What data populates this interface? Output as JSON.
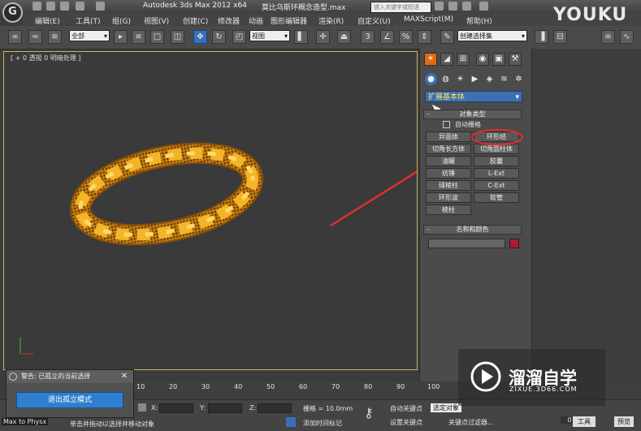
{
  "titlebar": {
    "app_title": "Autodesk 3ds Max  2012 x64",
    "file_title": "莫比乌斯环概念造型.max",
    "search_placeholder": "键入关键字或短语"
  },
  "menu": [
    "编辑(E)",
    "工具(T)",
    "组(G)",
    "视图(V)",
    "创建(C)",
    "修改器",
    "动画",
    "图形编辑器",
    "渲染(R)",
    "自定义(U)",
    "MAXScript(M)",
    "帮助(H)"
  ],
  "toolbar": {
    "selection_filter": "全部",
    "ref_coord": "视图",
    "named_selection": "创建选择集"
  },
  "viewport": {
    "label": "[ + 0 透视 0 明暗处理 ]"
  },
  "command_panel": {
    "category": "扩展基本体",
    "object_type_title": "对象类型",
    "auto_grid": "自动栅格",
    "buttons": [
      "异面体",
      "环形结",
      "切角长方体",
      "切角圆柱体",
      "油罐",
      "胶囊",
      "纺锤",
      "L-Ext",
      "球棱柱",
      "C-Ext",
      "环形波",
      "软管",
      "棱柱"
    ],
    "name_color_title": "名称和颜色",
    "object_color": "#b0183a"
  },
  "timeline": {
    "ticks": [
      "10",
      "20",
      "30",
      "40",
      "50",
      "60",
      "70",
      "80",
      "90",
      "100"
    ]
  },
  "status": {
    "x_label": "X:",
    "y_label": "Y:",
    "z_label": "Z:",
    "grid": "栅格 = 10.0mm",
    "auto_key": "自动关键点",
    "selected": "选定对象",
    "set_key": "设置关键点",
    "key_filter": "关键点过滤器...",
    "add_time_tag": "添加时间标记",
    "prompt": "单击并拖动以选择并移动对象",
    "left_label": "Max to Physx",
    "frame": "0",
    "tool_btn": "工具",
    "preview_btn": "预览"
  },
  "dialog": {
    "title": "警告: 已孤立的当前选择",
    "exit_button": "退出孤立模式"
  },
  "watermark": {
    "youku": "YOUKU",
    "brand": "溜溜自学",
    "url": "ZIXUE.3D66.COM"
  },
  "colors": {
    "ring_gold": "#e8a21a",
    "annotation_red": "#e0302a",
    "active_blue": "#3a6fb8"
  }
}
